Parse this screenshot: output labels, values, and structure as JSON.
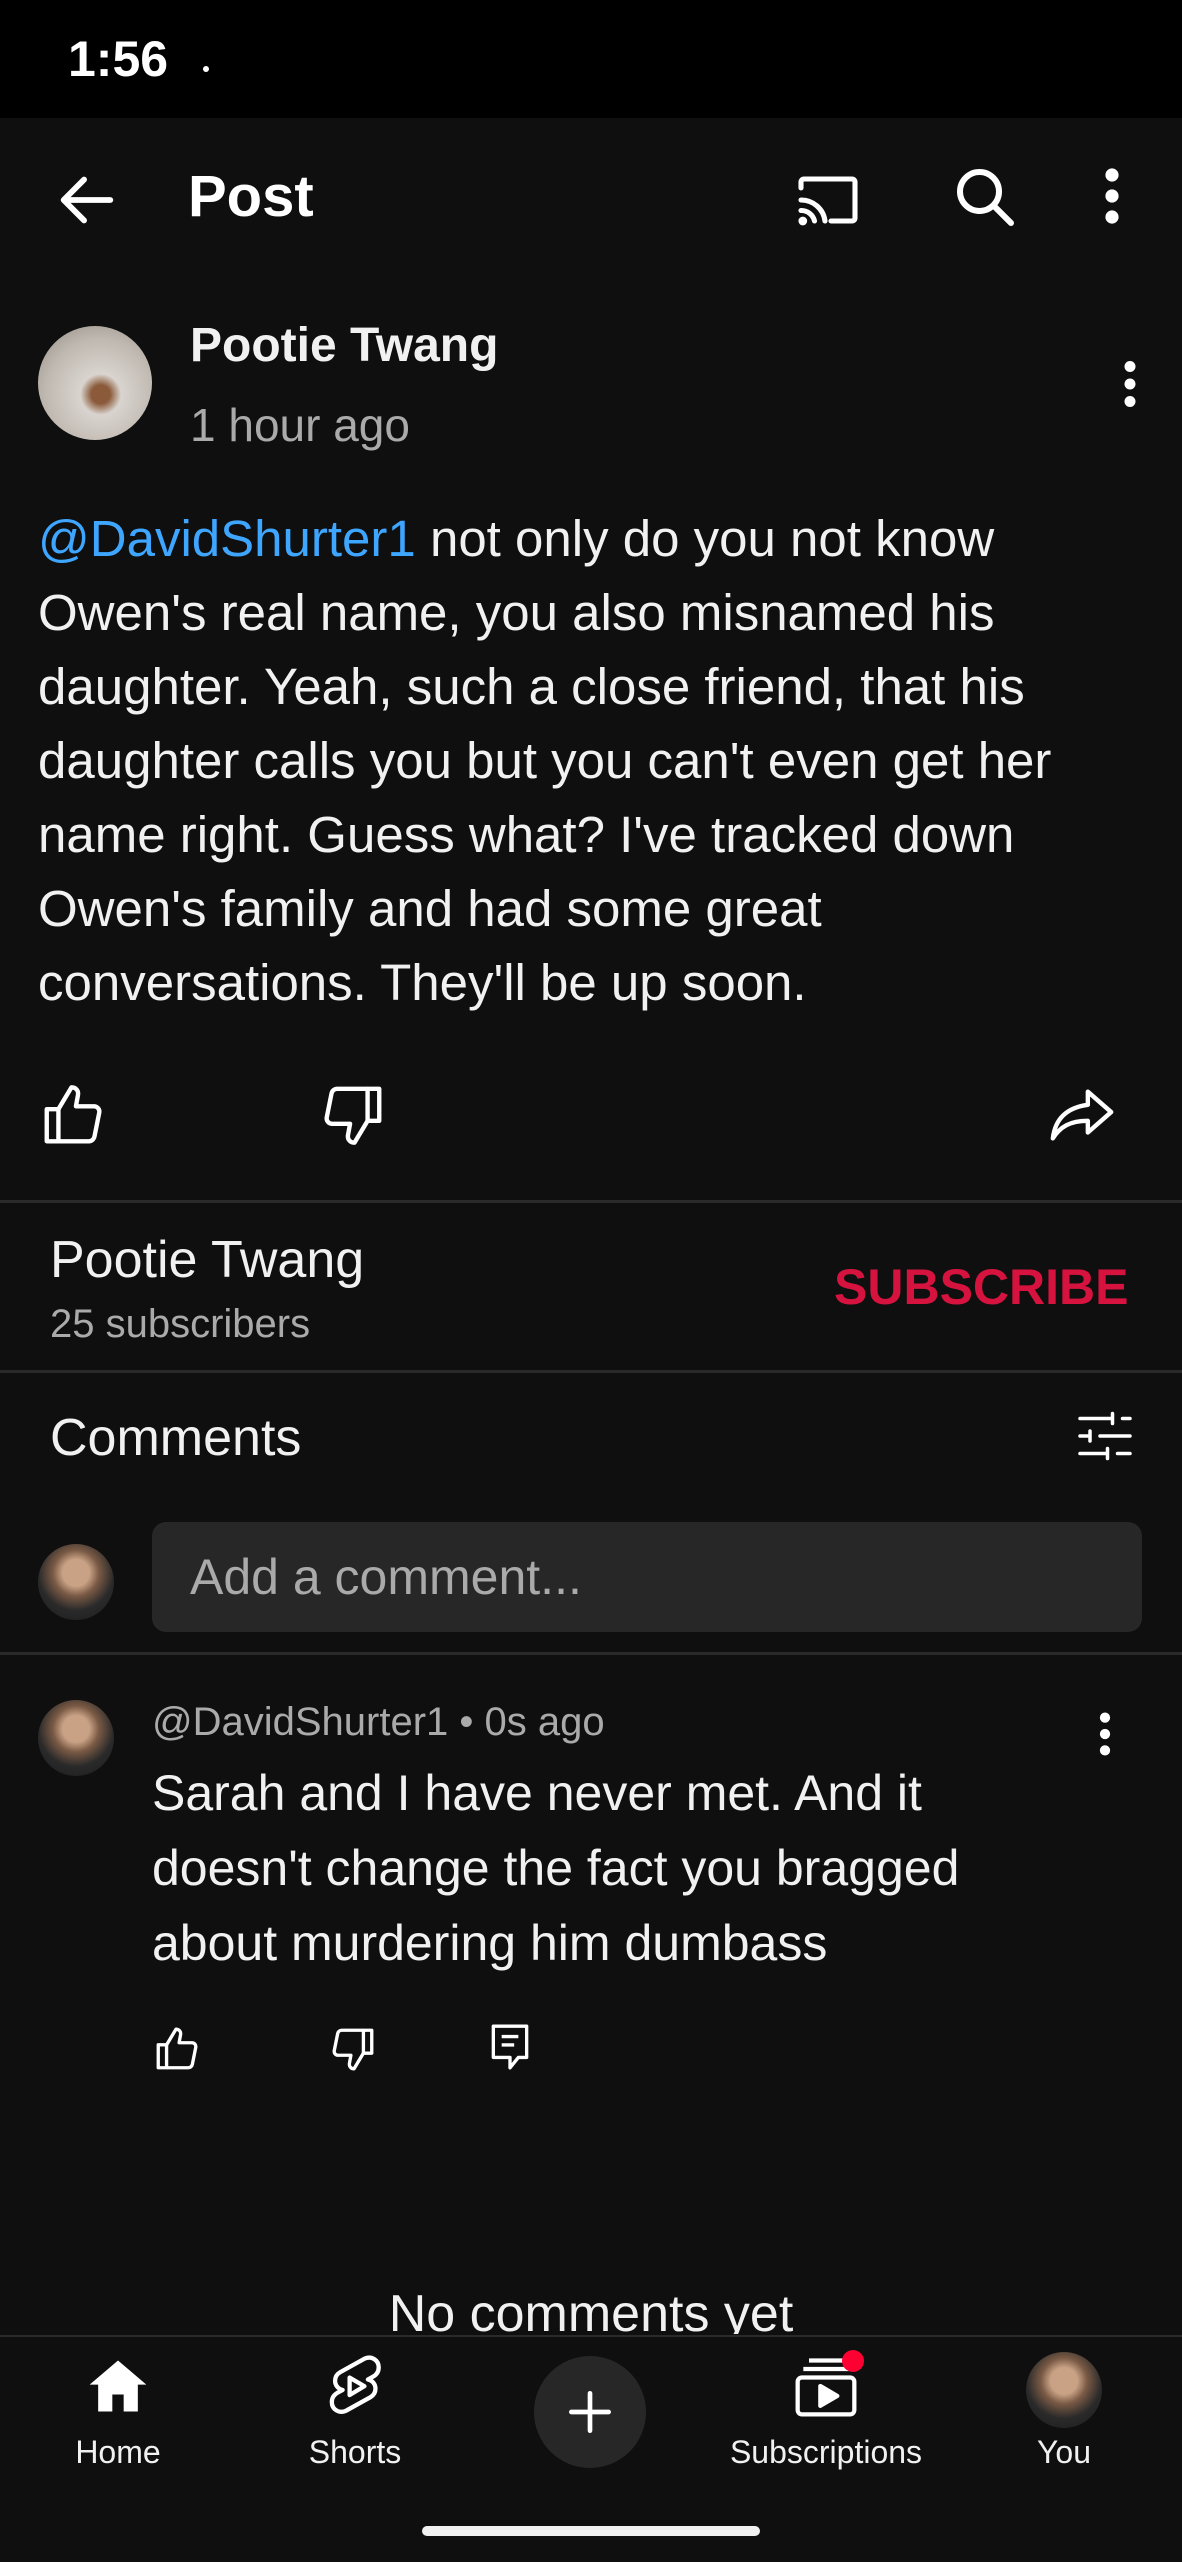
{
  "status_bar": {
    "time": "1:56"
  },
  "header": {
    "title": "Post",
    "icons": [
      "back-arrow-icon",
      "cast-icon",
      "search-icon",
      "more-vert-icon"
    ]
  },
  "post": {
    "author": "Pootie Twang",
    "time": "1 hour ago",
    "mention": "@DavidShurter1",
    "text": " not only do you not know Owen's real name, you also misnamed his daughter. Yeah, such a close friend, that his daughter calls you but you can't even get her name right. Guess what? I've tracked down Owen's family and had some great conversations. They'll be up soon.",
    "actions": [
      "thumb-up-icon",
      "thumb-down-icon",
      "share-icon"
    ]
  },
  "channel": {
    "name": "Pootie Twang",
    "subscribers": "25 subscribers",
    "subscribe_label": "SUBSCRIBE"
  },
  "comments": {
    "title": "Comments",
    "input_placeholder": "Add a comment...",
    "items": [
      {
        "meta": "@DavidShurter1 • 0s ago",
        "text": "Sarah and I have never met. And it doesn't change the fact you bragged about murdering him dumbass"
      }
    ],
    "empty_text": "No comments yet"
  },
  "bottom_nav": {
    "items": [
      {
        "label": "Home",
        "icon": "home-icon"
      },
      {
        "label": "Shorts",
        "icon": "shorts-icon"
      },
      {
        "label": "Subscriptions",
        "icon": "subscriptions-icon"
      },
      {
        "label": "You",
        "icon": "avatar"
      }
    ],
    "create_icon": "plus-icon"
  },
  "colors": {
    "background": "#0f0f0f",
    "mention": "#3ea6ff",
    "subscribe": "#d6133f",
    "badge": "#ff0033"
  }
}
